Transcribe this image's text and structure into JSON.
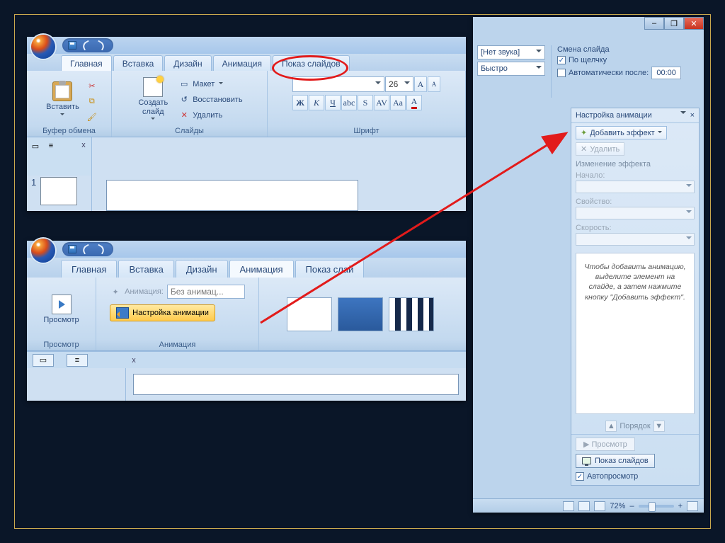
{
  "shot1": {
    "tabs": [
      "Главная",
      "Вставка",
      "Дизайн",
      "Анимация",
      "Показ слайдов"
    ],
    "active_tab": 0,
    "clipboard": {
      "paste": "Вставить",
      "group": "Буфер обмена"
    },
    "slides": {
      "new_slide": "Создать\nслайд",
      "layout": "Макет",
      "reset": "Восстановить",
      "delete": "Удалить",
      "group": "Слайды"
    },
    "font": {
      "size_value": "26",
      "bold": "Ж",
      "italic": "К",
      "underline": "Ч",
      "group": "Шрифт"
    },
    "slide_number": "1"
  },
  "shot2": {
    "tabs": [
      "Главная",
      "Вставка",
      "Дизайн",
      "Анимация",
      "Показ слай"
    ],
    "active_tab": 3,
    "preview": {
      "label": "Просмотр",
      "group": "Просмотр"
    },
    "anim": {
      "label": "Анимация:",
      "value": "Без анимац...",
      "custom": "Настройка анимации",
      "group": "Анимация"
    }
  },
  "right": {
    "sound_label": "[Нет звука]",
    "speed_label": "Быстро",
    "advance_title": "Смена слайда",
    "on_click": "По щелчку",
    "auto_after": "Автоматически после:",
    "auto_time": "00:00",
    "taskpane": {
      "title": "Настройка анимации",
      "add_effect": "Добавить эффект",
      "remove": "Удалить",
      "modify": "Изменение эффекта",
      "start": "Начало:",
      "property": "Свойство:",
      "speed": "Скорость:",
      "hint": "Чтобы добавить анимацию, выделите элемент на слайде, а затем нажмите кнопку \"Добавить эффект\".",
      "reorder": "Порядок",
      "play": "Просмотр",
      "slideshow": "Показ слайдов",
      "autopreview": "Автопросмотр"
    },
    "zoom": "72%"
  }
}
